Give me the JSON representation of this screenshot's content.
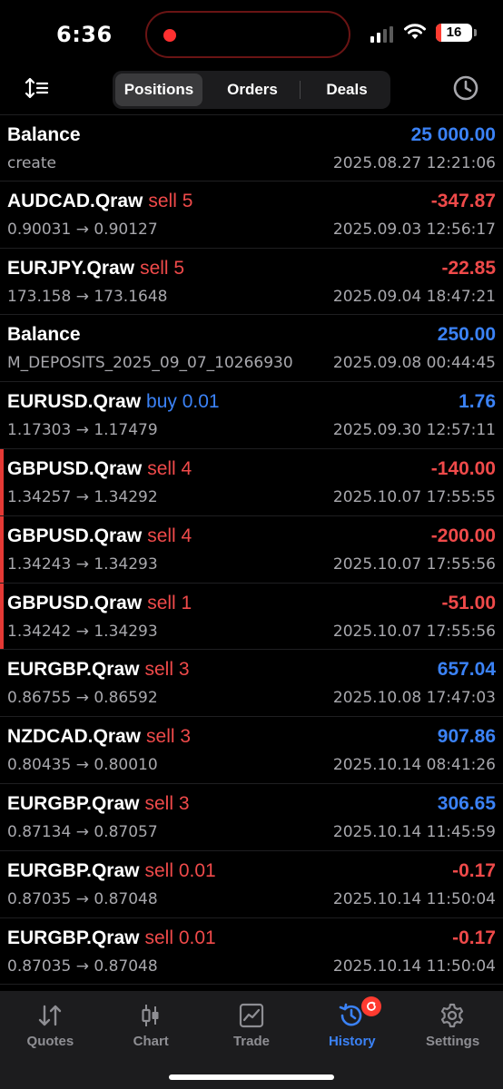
{
  "status_bar": {
    "time": "6:36",
    "battery_level": "16",
    "battery_fraction": 0.16,
    "recording_color": "#ff3030"
  },
  "toolbar": {
    "tabs": [
      {
        "label": "Positions",
        "active": true
      },
      {
        "label": "Orders",
        "active": false
      },
      {
        "label": "Deals",
        "active": false
      }
    ],
    "left_icon": "sort-icon",
    "right_icon": "clock-icon"
  },
  "colors": {
    "profit_positive": "#3b82f6",
    "profit_negative": "#ef4a4a",
    "accent": "#3b82f6"
  },
  "deals": [
    {
      "symbol": "Balance",
      "side": "",
      "side_type": "",
      "profit": "25 000.00",
      "profit_sign": "pos",
      "detail": "create",
      "date": "2025.08.27 12:21:06",
      "marker": false
    },
    {
      "symbol": "AUDCAD.Qraw",
      "side": "sell 5",
      "side_type": "sell",
      "profit": "-347.87",
      "profit_sign": "neg",
      "detail": "0.90031 → 0.90127",
      "date": "2025.09.03 12:56:17",
      "marker": false
    },
    {
      "symbol": "EURJPY.Qraw",
      "side": "sell 5",
      "side_type": "sell",
      "profit": "-22.85",
      "profit_sign": "neg",
      "detail": "173.158 → 173.1648",
      "date": "2025.09.04 18:47:21",
      "marker": false
    },
    {
      "symbol": "Balance",
      "side": "",
      "side_type": "",
      "profit": "250.00",
      "profit_sign": "pos",
      "detail": "M_DEPOSITS_2025_09_07_10266930",
      "date": "2025.09.08 00:44:45",
      "marker": false
    },
    {
      "symbol": "EURUSD.Qraw",
      "side": "buy 0.01",
      "side_type": "buy",
      "profit": "1.76",
      "profit_sign": "pos",
      "detail": "1.17303 → 1.17479",
      "date": "2025.09.30 12:57:11",
      "marker": false
    },
    {
      "symbol": "GBPUSD.Qraw",
      "side": "sell 4",
      "side_type": "sell",
      "profit": "-140.00",
      "profit_sign": "neg",
      "detail": "1.34257 → 1.34292",
      "date": "2025.10.07 17:55:55",
      "marker": true
    },
    {
      "symbol": "GBPUSD.Qraw",
      "side": "sell 4",
      "side_type": "sell",
      "profit": "-200.00",
      "profit_sign": "neg",
      "detail": "1.34243 → 1.34293",
      "date": "2025.10.07 17:55:56",
      "marker": true
    },
    {
      "symbol": "GBPUSD.Qraw",
      "side": "sell 1",
      "side_type": "sell",
      "profit": "-51.00",
      "profit_sign": "neg",
      "detail": "1.34242 → 1.34293",
      "date": "2025.10.07 17:55:56",
      "marker": true
    },
    {
      "symbol": "EURGBP.Qraw",
      "side": "sell 3",
      "side_type": "sell",
      "profit": "657.04",
      "profit_sign": "pos",
      "detail": "0.86755 → 0.86592",
      "date": "2025.10.08 17:47:03",
      "marker": false
    },
    {
      "symbol": "NZDCAD.Qraw",
      "side": "sell 3",
      "side_type": "sell",
      "profit": "907.86",
      "profit_sign": "pos",
      "detail": "0.80435 → 0.80010",
      "date": "2025.10.14 08:41:26",
      "marker": false
    },
    {
      "symbol": "EURGBP.Qraw",
      "side": "sell 3",
      "side_type": "sell",
      "profit": "306.65",
      "profit_sign": "pos",
      "detail": "0.87134 → 0.87057",
      "date": "2025.10.14 11:45:59",
      "marker": false
    },
    {
      "symbol": "EURGBP.Qraw",
      "side": "sell 0.01",
      "side_type": "sell",
      "profit": "-0.17",
      "profit_sign": "neg",
      "detail": "0.87035 → 0.87048",
      "date": "2025.10.14 11:50:04",
      "marker": false
    },
    {
      "symbol": "EURGBP.Qraw",
      "side": "sell 0.01",
      "side_type": "sell",
      "profit": "-0.17",
      "profit_sign": "neg",
      "detail": "0.87035 → 0.87048",
      "date": "2025.10.14 11:50:04",
      "marker": false
    }
  ],
  "tabbar": {
    "tabs": [
      {
        "label": "Quotes",
        "icon": "quotes-arrows-icon",
        "active": false
      },
      {
        "label": "Chart",
        "icon": "candlestick-chart-icon",
        "active": false
      },
      {
        "label": "Trade",
        "icon": "trade-chart-icon",
        "active": false
      },
      {
        "label": "History",
        "icon": "history-icon",
        "active": true
      },
      {
        "label": "Settings",
        "icon": "gear-icon",
        "active": false
      }
    ]
  }
}
